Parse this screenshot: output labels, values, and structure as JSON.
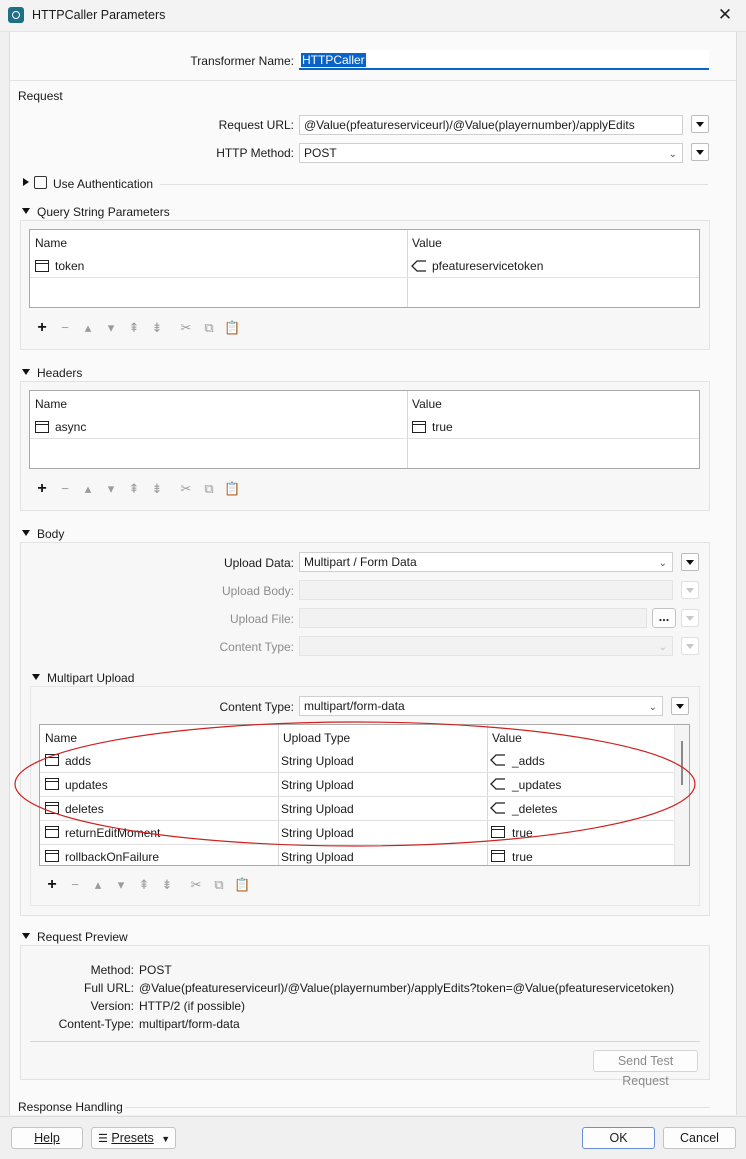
{
  "window": {
    "title": "HTTPCaller Parameters"
  },
  "transformer": {
    "label": "Transformer Name:",
    "value": "HTTPCaller"
  },
  "request": {
    "section_label": "Request",
    "url_label": "Request URL:",
    "url_value": "@Value(pfeatureserviceurl)/@Value(playernumber)/applyEdits",
    "method_label": "HTTP Method:",
    "method_value": "POST",
    "use_auth_label": "Use Authentication",
    "qs_label": "Query String Parameters",
    "qs_table": {
      "headers": [
        "Name",
        "Value"
      ],
      "rows": [
        {
          "name": "token",
          "value": "pfeatureservicetoken"
        }
      ]
    },
    "headers_label": "Headers",
    "headers_table": {
      "headers": [
        "Name",
        "Value"
      ],
      "rows": [
        {
          "name": "async",
          "value": "true"
        }
      ]
    }
  },
  "body": {
    "section_label": "Body",
    "upload_data_label": "Upload Data:",
    "upload_data_value": "Multipart / Form Data",
    "upload_body_label": "Upload Body:",
    "upload_file_label": "Upload File:",
    "upload_file_browse": "...",
    "content_type_label": "Content Type:",
    "multipart": {
      "label": "Multipart Upload",
      "content_type_label": "Content Type:",
      "content_type_value": "multipart/form-data",
      "table": {
        "headers": [
          "Name",
          "Upload Type",
          "Value"
        ],
        "rows": [
          {
            "name": "adds",
            "type": "String Upload",
            "value": "_adds",
            "value_icon": "attribute-icon"
          },
          {
            "name": "updates",
            "type": "String Upload",
            "value": "_updates",
            "value_icon": "attribute-icon"
          },
          {
            "name": "deletes",
            "type": "String Upload",
            "value": "_deletes",
            "value_icon": "attribute-icon"
          },
          {
            "name": "returnEditMoment",
            "type": "String Upload",
            "value": "true",
            "value_icon": "text-icon"
          },
          {
            "name": "rollbackOnFailure",
            "type": "String Upload",
            "value": "true",
            "value_icon": "text-icon"
          }
        ]
      }
    }
  },
  "preview": {
    "label": "Request Preview",
    "method_key": "Method:",
    "method_val": "POST",
    "url_key": "Full URL:",
    "url_val": "@Value(pfeatureserviceurl)/@Value(playernumber)/applyEdits?token=@Value(pfeatureservicetoken)",
    "version_key": "Version:",
    "version_val": "HTTP/2 (if possible)",
    "ctype_key": "Content-Type:",
    "ctype_val": "multipart/form-data",
    "send_test": "Send Test Request"
  },
  "response": {
    "label": "Response Handling"
  },
  "footer": {
    "help": "Help",
    "presets": "Presets",
    "ok": "OK",
    "cancel": "Cancel"
  },
  "colors": {
    "highlight_ellipse": "#d02020",
    "selection": "#0a64c8"
  }
}
